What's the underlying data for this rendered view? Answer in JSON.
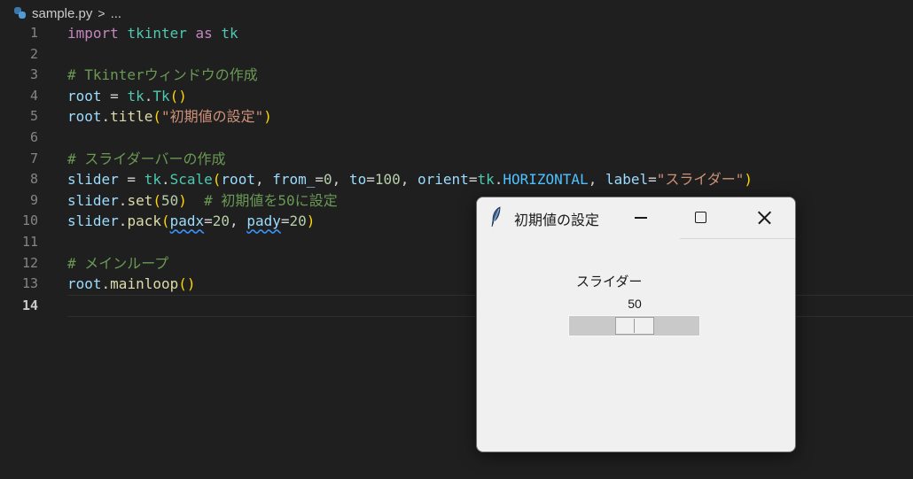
{
  "breadcrumb": {
    "file": "sample.py",
    "separator": ">",
    "more": "..."
  },
  "editor": {
    "lines": [
      {
        "n": "1",
        "segs": [
          [
            "import ",
            "kw"
          ],
          [
            "tkinter",
            "mod"
          ],
          [
            " as ",
            "kw"
          ],
          [
            "tk",
            "mod"
          ]
        ]
      },
      {
        "n": "2",
        "segs": []
      },
      {
        "n": "3",
        "segs": [
          [
            "# Tkinterウィンドウの作成",
            "cmt"
          ]
        ]
      },
      {
        "n": "4",
        "segs": [
          [
            "root",
            "var"
          ],
          [
            " = ",
            "op"
          ],
          [
            "tk",
            "mod"
          ],
          [
            ".",
            "op"
          ],
          [
            "Tk",
            "cls"
          ],
          [
            "()",
            "br"
          ]
        ]
      },
      {
        "n": "5",
        "segs": [
          [
            "root",
            "var"
          ],
          [
            ".",
            "op"
          ],
          [
            "title",
            "fn"
          ],
          [
            "(",
            "br"
          ],
          [
            "\"初期値の設定\"",
            "str"
          ],
          [
            ")",
            "br"
          ]
        ]
      },
      {
        "n": "6",
        "segs": []
      },
      {
        "n": "7",
        "segs": [
          [
            "# スライダーバーの作成",
            "cmt"
          ]
        ]
      },
      {
        "n": "8",
        "segs": [
          [
            "slider",
            "var"
          ],
          [
            " = ",
            "op"
          ],
          [
            "tk",
            "mod"
          ],
          [
            ".",
            "op"
          ],
          [
            "Scale",
            "cls"
          ],
          [
            "(",
            "br"
          ],
          [
            "root",
            "var"
          ],
          [
            ", ",
            "op"
          ],
          [
            "from_",
            "var"
          ],
          [
            "=",
            "op"
          ],
          [
            "0",
            "num"
          ],
          [
            ", ",
            "op"
          ],
          [
            "to",
            "var"
          ],
          [
            "=",
            "op"
          ],
          [
            "100",
            "num"
          ],
          [
            ", ",
            "op"
          ],
          [
            "orient",
            "var"
          ],
          [
            "=",
            "op"
          ],
          [
            "tk",
            "mod"
          ],
          [
            ".",
            "op"
          ],
          [
            "HORIZONTAL",
            "const"
          ],
          [
            ", ",
            "op"
          ],
          [
            "label",
            "var"
          ],
          [
            "=",
            "op"
          ],
          [
            "\"スライダー\"",
            "str"
          ],
          [
            ")",
            "br"
          ]
        ]
      },
      {
        "n": "9",
        "segs": [
          [
            "slider",
            "var"
          ],
          [
            ".",
            "op"
          ],
          [
            "set",
            "fn"
          ],
          [
            "(",
            "br"
          ],
          [
            "50",
            "num"
          ],
          [
            ")",
            "br"
          ],
          [
            "  # 初期値を50に設定",
            "cmt"
          ]
        ]
      },
      {
        "n": "10",
        "segs": [
          [
            "slider",
            "var"
          ],
          [
            ".",
            "op"
          ],
          [
            "pack",
            "fn"
          ],
          [
            "(",
            "br"
          ],
          [
            "padx",
            "var-wavy"
          ],
          [
            "=",
            "op"
          ],
          [
            "20",
            "num"
          ],
          [
            ", ",
            "op"
          ],
          [
            "pady",
            "var-wavy"
          ],
          [
            "=",
            "op"
          ],
          [
            "20",
            "num"
          ],
          [
            ")",
            "br"
          ]
        ]
      },
      {
        "n": "11",
        "segs": []
      },
      {
        "n": "12",
        "segs": [
          [
            "# メインループ",
            "cmt"
          ]
        ]
      },
      {
        "n": "13",
        "segs": [
          [
            "root",
            "var"
          ],
          [
            ".",
            "op"
          ],
          [
            "mainloop",
            "fn"
          ],
          [
            "()",
            "br"
          ]
        ]
      },
      {
        "n": "14",
        "segs": [],
        "active": true
      }
    ]
  },
  "tk_window": {
    "title": "初期値の設定",
    "icon": "feather-icon",
    "scale": {
      "label": "スライダー",
      "value": "50",
      "from": 0,
      "to": 100,
      "current": 50
    }
  },
  "colors": {
    "editor_bg": "#1f1f1f",
    "keyword": "#c586c0",
    "module": "#4ec9b0",
    "variable": "#9cdcfe",
    "function": "#dcdcaa",
    "string": "#ce9178",
    "number": "#b5cea8",
    "comment": "#6a9955",
    "window_bg": "#f0f0f0"
  }
}
